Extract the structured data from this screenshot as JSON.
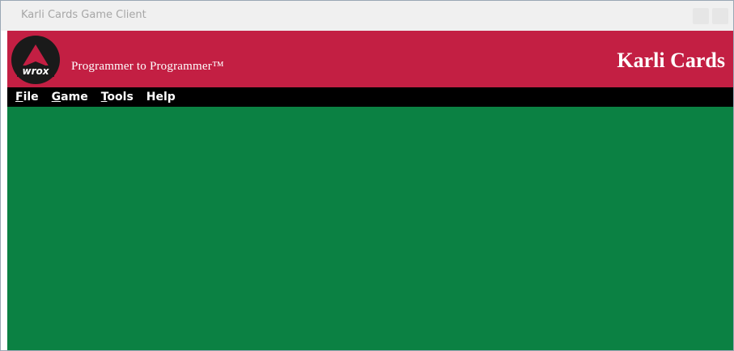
{
  "window": {
    "title": "Karli Cards Game Client"
  },
  "banner": {
    "logo_text": "wrox",
    "tagline": "Programmer to Programmer™",
    "app_title": "Karli Cards",
    "background_color": "#c31f43"
  },
  "menu": {
    "items": [
      {
        "label": "File",
        "access_key": "F",
        "rest": "ile"
      },
      {
        "label": "Game",
        "access_key": "G",
        "rest": "ame"
      },
      {
        "label": "Tools",
        "access_key": "T",
        "rest": "ools"
      },
      {
        "label": "Help",
        "access_key": "",
        "rest": "Help"
      }
    ]
  },
  "game_area": {
    "color": "#0b8143"
  }
}
